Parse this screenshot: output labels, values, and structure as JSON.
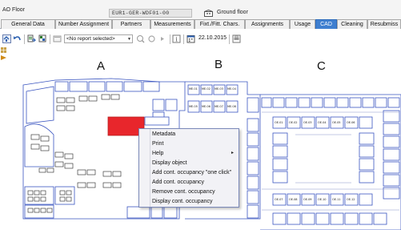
{
  "window": {
    "title": "AO Floor",
    "floor_code": "EUR1-GER-WDF01-00",
    "floor_name": "Ground floor"
  },
  "tabs": [
    {
      "label": "General Data",
      "active": false
    },
    {
      "label": "Number Assignment",
      "active": false
    },
    {
      "label": "Partners",
      "active": false
    },
    {
      "label": "Measurements",
      "active": false
    },
    {
      "label": "Fixt./Fitt. Chars.",
      "active": false
    },
    {
      "label": "Assignments",
      "active": false
    },
    {
      "label": "Usage",
      "active": false
    },
    {
      "label": "CAD",
      "active": true
    },
    {
      "label": "Cleaning",
      "active": false
    },
    {
      "label": "Resubmiss",
      "active": false
    }
  ],
  "toolbar": {
    "report_select_value": "<No report selected>",
    "date": "22.10.2015",
    "icons": [
      "open-icon",
      "undo-icon",
      "export-icon",
      "layers-icon",
      "zoom-in-icon",
      "zoom-out-icon",
      "info-icon",
      "calendar-icon",
      "print-icon"
    ]
  },
  "drawing": {
    "blocks": [
      "A",
      "B",
      "C"
    ],
    "highlight_color": "#e8262c",
    "room_labels_b": [
      "ME.01",
      "ME.02",
      "ME.03",
      "ME.04",
      "ME.05",
      "ME.06",
      "ME.07",
      "ME.08"
    ],
    "room_labels_c": [
      "OE.01",
      "OE.02",
      "OE.03",
      "OE.04",
      "OE.05",
      "OE.06",
      "OE.07",
      "OE.08",
      "OE.09",
      "OE.10",
      "OE.11",
      "OE.12"
    ]
  },
  "context_menu": {
    "items": [
      {
        "label": "Metadata",
        "submenu": false
      },
      {
        "label": "Print",
        "submenu": false
      },
      {
        "label": "Help",
        "submenu": true
      },
      {
        "label": "Display object",
        "submenu": false
      },
      {
        "label": "Add cont. occupancy \"one click\"",
        "submenu": false
      },
      {
        "label": "Add cont. occupancy",
        "submenu": false
      },
      {
        "label": "Remove cont. occupancy",
        "submenu": false
      },
      {
        "label": "Display cont. occupancy",
        "submenu": false
      }
    ]
  }
}
